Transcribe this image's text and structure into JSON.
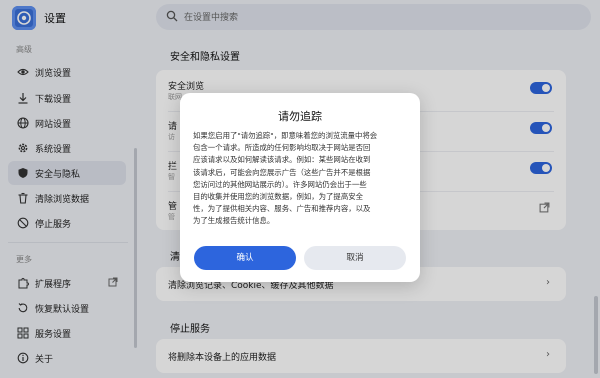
{
  "app": {
    "title": "设置"
  },
  "search": {
    "placeholder": "在设置中搜索"
  },
  "sidebar": {
    "section_main": "高级",
    "items": [
      {
        "label": "浏览设置",
        "icon": "eye-icon"
      },
      {
        "label": "下载设置",
        "icon": "download-icon"
      },
      {
        "label": "网站设置",
        "icon": "globe-icon"
      },
      {
        "label": "系统设置",
        "icon": "gear-icon"
      },
      {
        "label": "安全与隐私",
        "icon": "shield-icon",
        "active": true
      },
      {
        "label": "清除浏览数据",
        "icon": "trash-icon"
      },
      {
        "label": "停止服务",
        "icon": "block-icon"
      }
    ],
    "section_more": "更多",
    "more_items": [
      {
        "label": "扩展程序",
        "icon": "puzzle-icon"
      },
      {
        "label": "恢复默认设置",
        "icon": "restore-icon"
      },
      {
        "label": "服务设置",
        "icon": "grid-icon"
      },
      {
        "label": "关于",
        "icon": "info-icon"
      }
    ]
  },
  "main": {
    "security_title": "安全和隐私设置",
    "rows": [
      {
        "title": "安全浏览",
        "subtitle": "联网"
      },
      {
        "title": "请",
        "subtitle": "访"
      },
      {
        "title": "拦",
        "subtitle": "智"
      },
      {
        "title": "管",
        "subtitle": "管"
      }
    ],
    "clear_title": "清",
    "clear_row": "清除浏览记录、Cookie、缓存及其他数据",
    "stop_title": "停止服务",
    "stop_row": "将删除本设备上的应用数据"
  },
  "dialog": {
    "title": "请勿追踪",
    "body": "如果您启用了\"请勿追踪\"，即意味着您的浏览流量中将会\n包含一个请求。所造成的任何影响均取决于网站是否回\n应该请求以及如何解读该请求。例如：某些网站在收到\n该请求后，可能会向您展示广告（这些广告并不是根据\n您访问过的其他网站展示的）。许多网站仍会出于一些\n目的收集并使用您的浏览数据，例如，为了提高安全\n性，为了提供相关内容、服务、广告和推荐内容，以及\n为了生成报告统计信息。",
    "confirm": "确认",
    "cancel": "取消"
  }
}
